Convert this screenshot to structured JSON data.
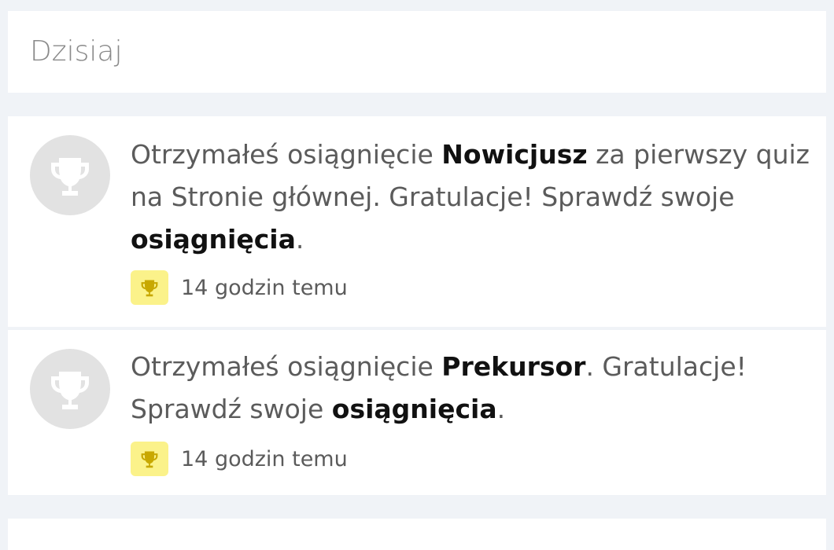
{
  "section": {
    "title": "Dzisiaj"
  },
  "notifications": [
    {
      "icon": "trophy-icon",
      "text_before": "Otrzymałeś osiągnięcie ",
      "achievement": "Nowicjusz",
      "text_middle": " za pierwszy quiz na Stronie głównej. Gratulacje! Sprawdź swoje ",
      "link": "osiągnięcia",
      "text_after": ".",
      "badge_icon": "trophy-icon",
      "time": "14 godzin temu"
    },
    {
      "icon": "trophy-icon",
      "text_before": "Otrzymałeś osiągnięcie ",
      "achievement": "Prekursor",
      "text_middle": ". Gratulacje! Sprawdź swoje ",
      "link": "osiągnięcia",
      "text_after": ".",
      "badge_icon": "trophy-icon",
      "time": "14 godzin temu"
    }
  ],
  "colors": {
    "badge_background": "#fbf28a",
    "badge_icon": "#c8a800",
    "avatar_background": "#e2e2e2"
  }
}
